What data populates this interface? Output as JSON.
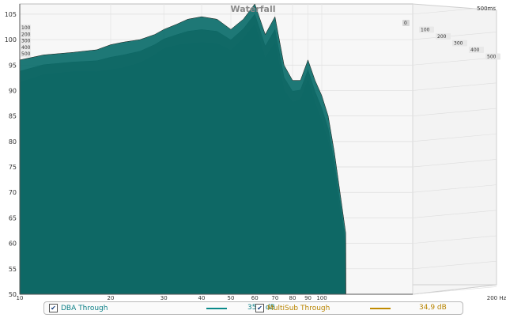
{
  "chart_data": {
    "type": "area",
    "title": "Waterfall",
    "time_axis_label": "500ms",
    "time_ticks": [
      "0",
      "100",
      "200",
      "300",
      "400",
      "500"
    ],
    "left_time_ticks": [
      "100",
      "200",
      "300",
      "400",
      "500"
    ],
    "xlabel_unit": "Hz",
    "x_scale": "log",
    "xlim": [
      10,
      200
    ],
    "ylim": [
      50,
      107
    ],
    "y_ticks": [
      50,
      55,
      60,
      65,
      70,
      75,
      80,
      85,
      90,
      95,
      100,
      105
    ],
    "x_tick_labels": [
      "10",
      "20",
      "30",
      "40",
      "50",
      "60",
      "70",
      "80",
      "90",
      "100",
      "200 Hz"
    ],
    "x_tick_values": [
      10,
      20,
      30,
      40,
      50,
      60,
      70,
      80,
      90,
      100,
      200
    ],
    "grid": true,
    "series": [
      {
        "name": "DBA Through",
        "color": "#0b8a8a",
        "x": [
          10,
          12,
          15,
          18,
          20,
          22,
          25,
          28,
          30,
          33,
          36,
          40,
          45,
          50,
          55,
          60,
          65,
          70,
          75,
          80,
          85,
          90,
          95,
          100,
          105,
          110,
          120
        ],
        "values": [
          96,
          97,
          97.5,
          98,
          99,
          99.5,
          100,
          101,
          102,
          103,
          104,
          104.5,
          104,
          102,
          104,
          107,
          101,
          104.5,
          95,
          92,
          92,
          96,
          92,
          89,
          85,
          78,
          62
        ]
      }
    ]
  },
  "legend": [
    {
      "label": "DBA Through",
      "value": "35,8 dB",
      "color": "#0b8a8a",
      "checked": true
    },
    {
      "label": "MultiSub Through",
      "value": "34,9 dB",
      "color": "#c08a00",
      "checked": true
    }
  ]
}
